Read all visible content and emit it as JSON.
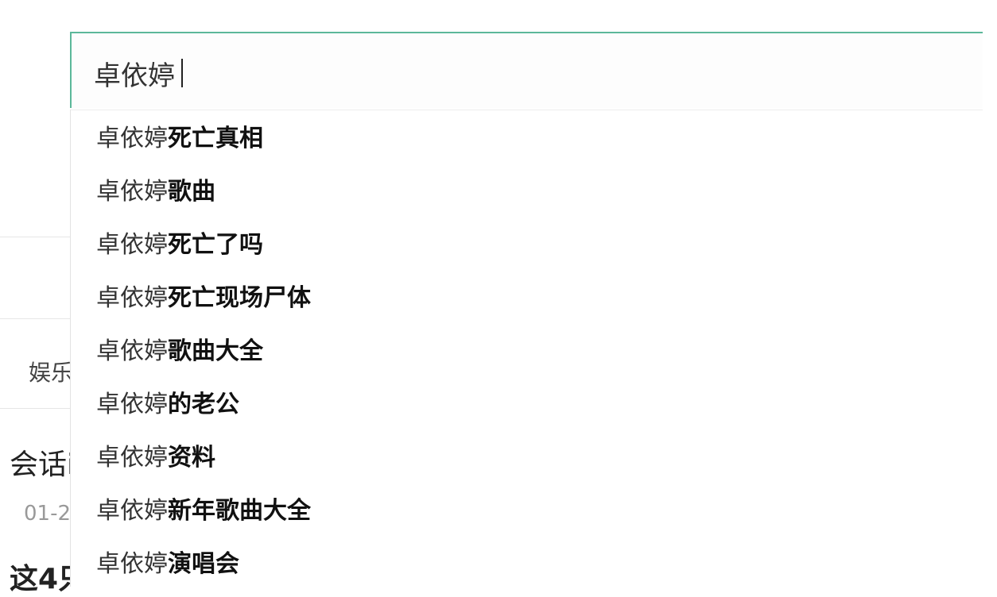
{
  "background_page": {
    "category_fragment": "娱乐",
    "headline_fragment": "会话i",
    "date_fragment": "01-2",
    "headline2_fragment": "这4只"
  },
  "search": {
    "query": "卓依婷"
  },
  "suggestions": [
    {
      "prefix": "卓依婷",
      "suffix": "死亡真相"
    },
    {
      "prefix": "卓依婷",
      "suffix": "歌曲"
    },
    {
      "prefix": "卓依婷",
      "suffix": "死亡了吗"
    },
    {
      "prefix": "卓依婷",
      "suffix": "死亡现场尸体"
    },
    {
      "prefix": "卓依婷",
      "suffix": "歌曲大全"
    },
    {
      "prefix": "卓依婷",
      "suffix": "的老公"
    },
    {
      "prefix": "卓依婷",
      "suffix": "资料"
    },
    {
      "prefix": "卓依婷",
      "suffix": "新年歌曲大全"
    },
    {
      "prefix": "卓依婷",
      "suffix": "演唱会"
    }
  ],
  "colors": {
    "focus_border": "#5cb89a",
    "text": "#333333"
  }
}
